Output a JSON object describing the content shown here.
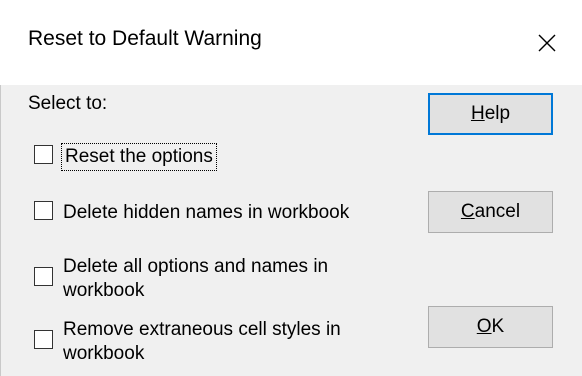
{
  "window": {
    "title": "Reset to Default Warning",
    "close_icon": "close-icon"
  },
  "prompt": "Select to:",
  "options": [
    {
      "label": "Reset the options",
      "checked": false,
      "focused": true
    },
    {
      "label": "Delete hidden names in workbook",
      "checked": false,
      "focused": false
    },
    {
      "label_line1": "Delete all options and names in",
      "label_line2": "workbook",
      "checked": false,
      "focused": false
    },
    {
      "label_line1": "Remove extraneous cell styles in",
      "label_line2": "workbook",
      "checked": false,
      "focused": false
    }
  ],
  "buttons": {
    "help": {
      "mnemonic": "H",
      "rest": "elp"
    },
    "cancel": {
      "mnemonic": "C",
      "rest": "ancel"
    },
    "ok": {
      "mnemonic": "O",
      "rest": "K"
    }
  },
  "colors": {
    "default_button_border": "#0078d7"
  }
}
